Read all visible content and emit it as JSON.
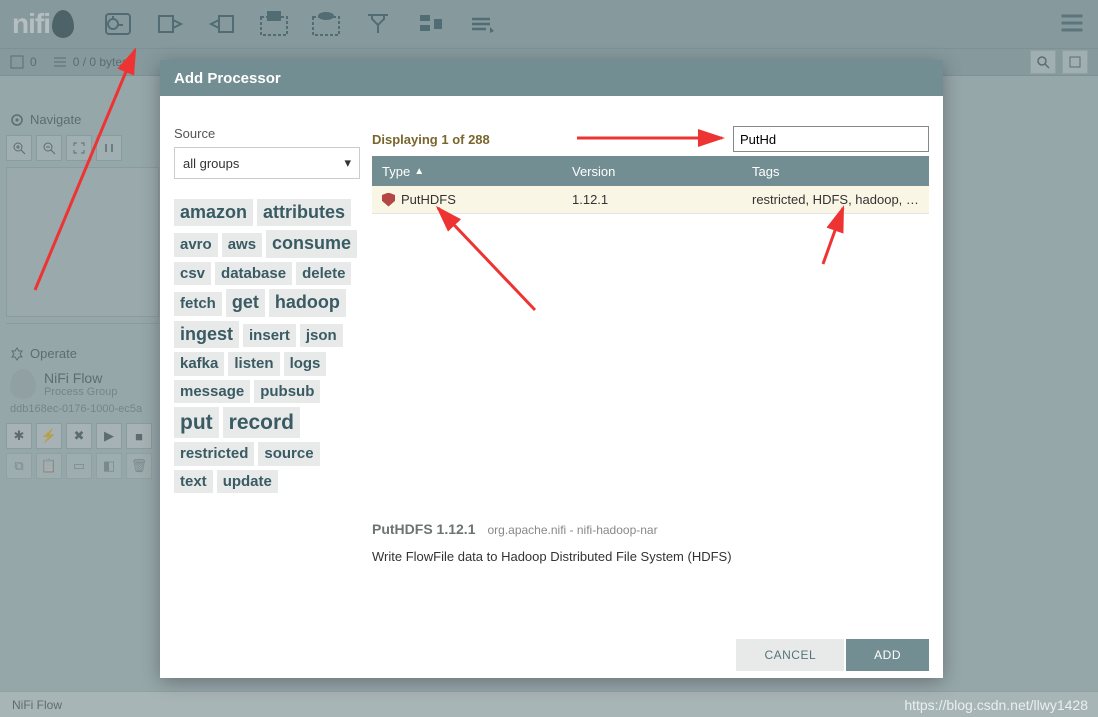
{
  "header": {
    "logo_text": "nifi"
  },
  "status": {
    "count1": "0",
    "bytes": "0 / 0 bytes"
  },
  "navigate": {
    "title": "Navigate"
  },
  "operate": {
    "title": "Operate",
    "flow_name": "NiFi Flow",
    "flow_type": "Process Group",
    "flow_id": "ddb168ec-0176-1000-ec5a"
  },
  "footer": {
    "breadcrumb": "NiFi Flow"
  },
  "watermark": "https://blog.csdn.net/llwy1428",
  "modal": {
    "title": "Add Processor",
    "source_label": "Source",
    "source_value": "all groups",
    "displaying_count": "Displaying 1 of 288",
    "filter_value": "PutHd",
    "columns": {
      "type": "Type",
      "version": "Version",
      "tags": "Tags"
    },
    "row": {
      "type": "PutHDFS",
      "version": "1.12.1",
      "tags": "restricted, HDFS, hadoop, copy, ..."
    },
    "details": {
      "name": "PutHDFS 1.12.1",
      "bundle": "org.apache.nifi - nifi-hadoop-nar",
      "description": "Write FlowFile data to Hadoop Distributed File System (HDFS)"
    },
    "buttons": {
      "cancel": "CANCEL",
      "add": "ADD"
    },
    "tags": [
      "amazon",
      "attributes",
      "avro",
      "aws",
      "consume",
      "csv",
      "database",
      "delete",
      "fetch",
      "get",
      "hadoop",
      "ingest",
      "insert",
      "json",
      "kafka",
      "listen",
      "logs",
      "message",
      "pubsub",
      "put",
      "record",
      "restricted",
      "source",
      "text",
      "update"
    ]
  }
}
